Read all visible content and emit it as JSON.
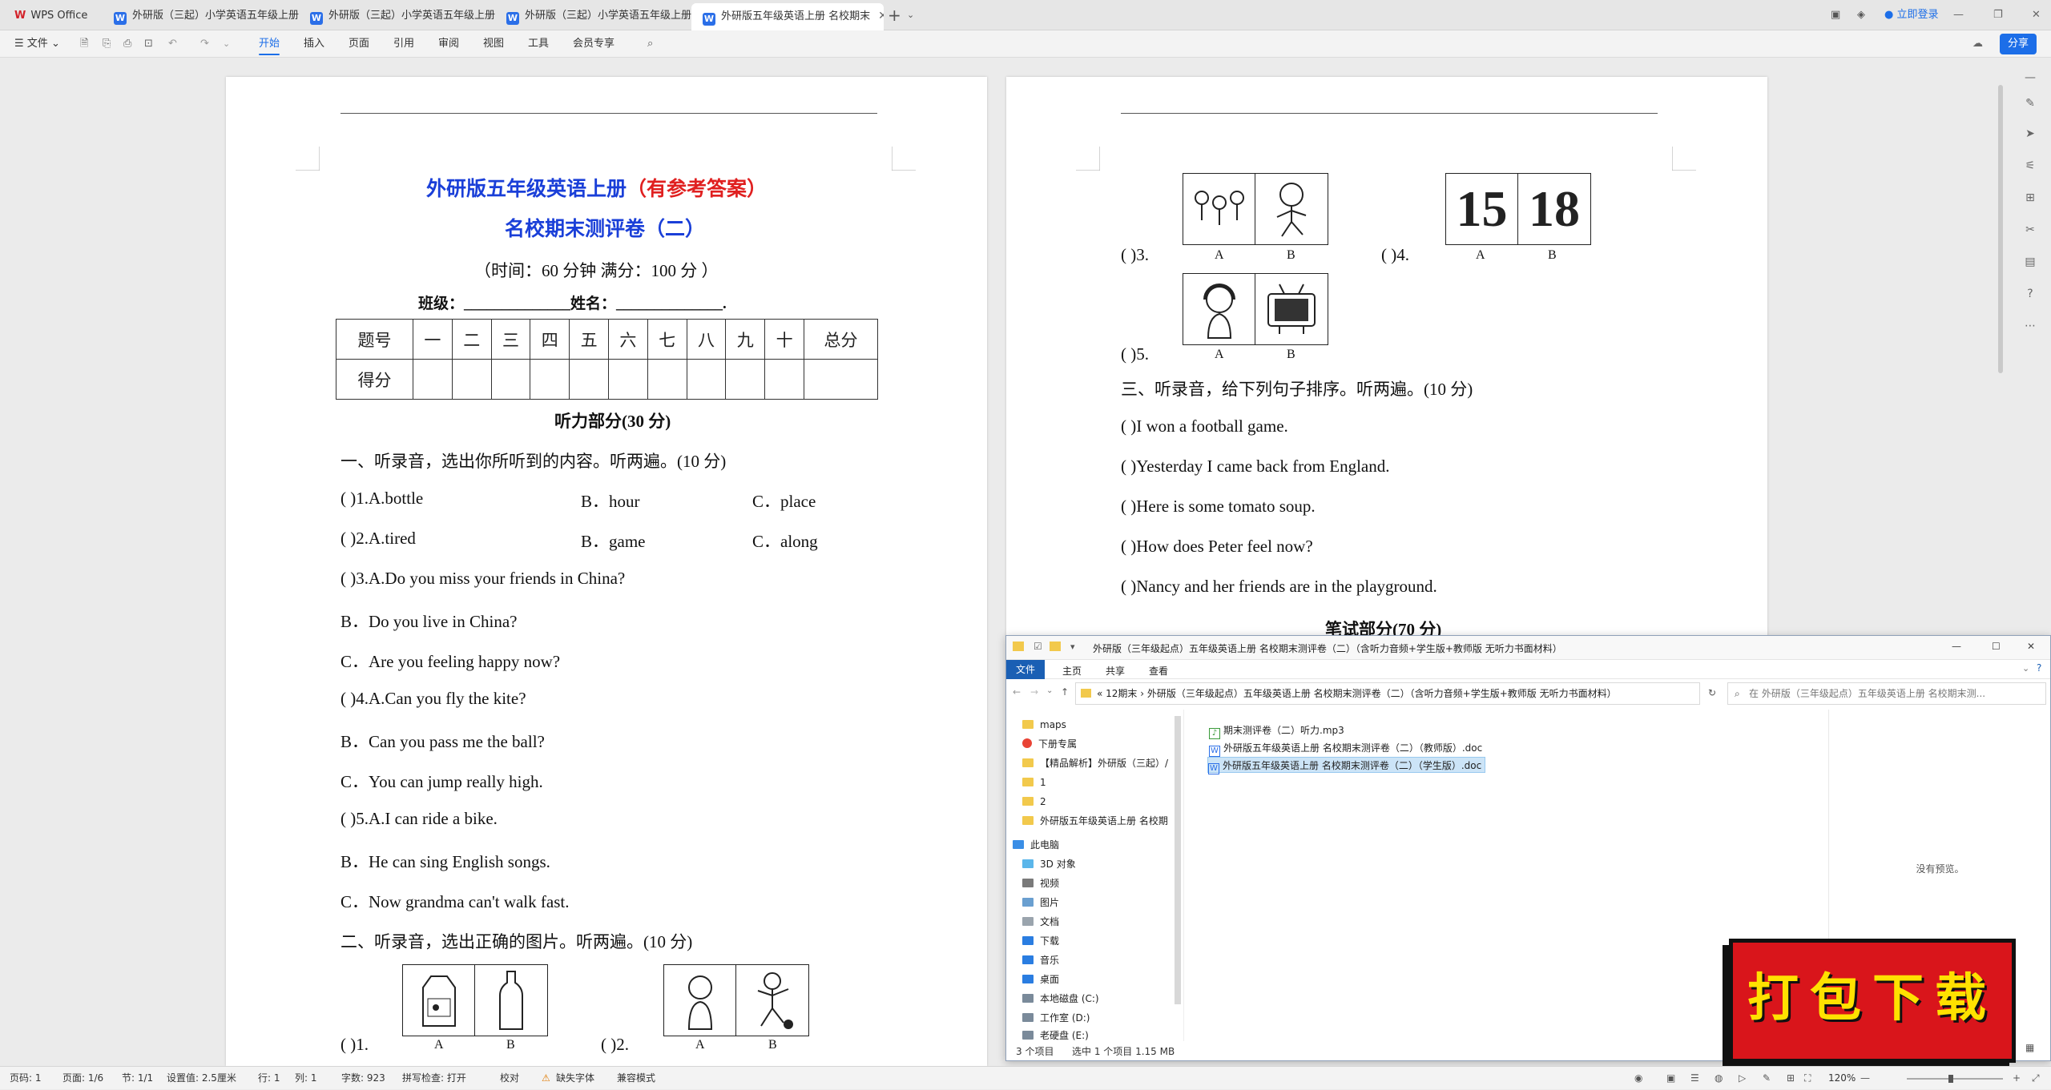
{
  "tabs": {
    "home": "WPS Office",
    "t1": "外研版（三起）小学英语五年级上册期末",
    "t2": "外研版（三起）小学英语五年级上册期末",
    "t3": "外研版（三起）小学英语五年级上册期末",
    "t4": "外研版五年级英语上册 名校期末"
  },
  "window": {
    "login": "立即登录",
    "share": "分享"
  },
  "toolbar": {
    "file": "文件",
    "menu": [
      "开始",
      "插入",
      "页面",
      "引用",
      "审阅",
      "视图",
      "工具",
      "会员专享"
    ]
  },
  "page1": {
    "title": "外研版五年级英语上册",
    "title_red": "（有参考答案）",
    "subtitle": "名校期末测评卷（二）",
    "time": "（时间：60 分钟    满分：100 分  ）",
    "class_label": "班级：______________姓名：______________.",
    "table_head": [
      "题号",
      "一",
      "二",
      "三",
      "四",
      "五",
      "六",
      "七",
      "八",
      "九",
      "十",
      "总分"
    ],
    "table_row": "得分",
    "listen_head": "听力部分(30 分)",
    "s1": "一、听录音，选出你所听到的内容。听两遍。(10 分)",
    "q1a": "(        )1.A.bottle",
    "q1b": "B．hour",
    "q1c": "C．place",
    "q2a": "(        )2.A.tired",
    "q2b": "B．game",
    "q2c": "C．along",
    "q3": "(        )3.A.Do you miss your friends in China?",
    "q3b": "B．Do you live in China?",
    "q3c": "C．Are you feeling happy now?",
    "q4": "(        )4.A.Can you fly the kite?",
    "q4b": "B．Can you pass me the ball?",
    "q4c": "C．You can jump really high.",
    "q5": "(        )5.A.I can ride a bike.",
    "q5b": "B．He can sing English songs.",
    "q5c": "C．Now grandma can't walk fast.",
    "s2": "二、听录音，选出正确的图片。听两遍。(10 分)",
    "p1": "(        )1.",
    "p2": "(        )2.",
    "A": "A",
    "B": "B"
  },
  "page2": {
    "p3": "(        )3.",
    "p4": "(        )4.",
    "p5": "(        )5.",
    "n1": "15",
    "n2": "18",
    "A": "A",
    "B": "B",
    "s3": "三、听录音，给下列句子排序。听两遍。(10 分)",
    "r1": "(        )I won a football game.",
    "r2": "(        )Yesterday I came back from England.",
    "r3": "(        )Here is some tomato soup.",
    "r4": "(        )How does Peter feel now?",
    "r5": "(        )Nancy and her friends are in the playground.",
    "written_head": "笔试部分(70 分)"
  },
  "explorer": {
    "title": "外研版（三年级起点）五年级英语上册 名校期末测评卷（二）（含听力音频+学生版+教师版 无听力书面材料）",
    "ribbon": [
      "文件",
      "主页",
      "共享",
      "查看"
    ],
    "path": "«  12期末  ›  外研版（三年级起点）五年级英语上册 名校期末测评卷（二）（含听力音频+学生版+教师版 无听力书面材料）",
    "search": "在 外研版（三年级起点）五年级英语上册 名校期末测...",
    "nav": [
      "maps",
      "下册专属",
      "【精品解析】外研版（三起）/",
      "1",
      "2",
      "外研版五年级英语上册 名校期",
      "此电脑",
      "3D 对象",
      "视频",
      "图片",
      "文档",
      "下载",
      "音乐",
      "桌面",
      "本地磁盘 (C:)",
      "工作室 (D:)",
      "老硬盘 (E:)"
    ],
    "files": [
      "期末测评卷（二）听力.mp3",
      "外研版五年级英语上册 名校期末测评卷（二）（教师版）.doc",
      "外研版五年级英语上册 名校期末测评卷（二）（学生版）.doc"
    ],
    "preview": "没有预览。",
    "status_count": "3 个项目",
    "status_sel": "选中 1 个项目  1.15 MB"
  },
  "badge": "打包下载",
  "status": {
    "page": "页码: 1",
    "pages": "页面: 1/6",
    "section": "节: 1/1",
    "setting": "设置值: 2.5厘米",
    "row": "行: 1",
    "col": "列: 1",
    "words": "字数: 923",
    "spell": "拼写检查: 打开",
    "proof": "校对",
    "font": "缺失字体",
    "compat": "兼容模式",
    "zoom": "120%"
  }
}
